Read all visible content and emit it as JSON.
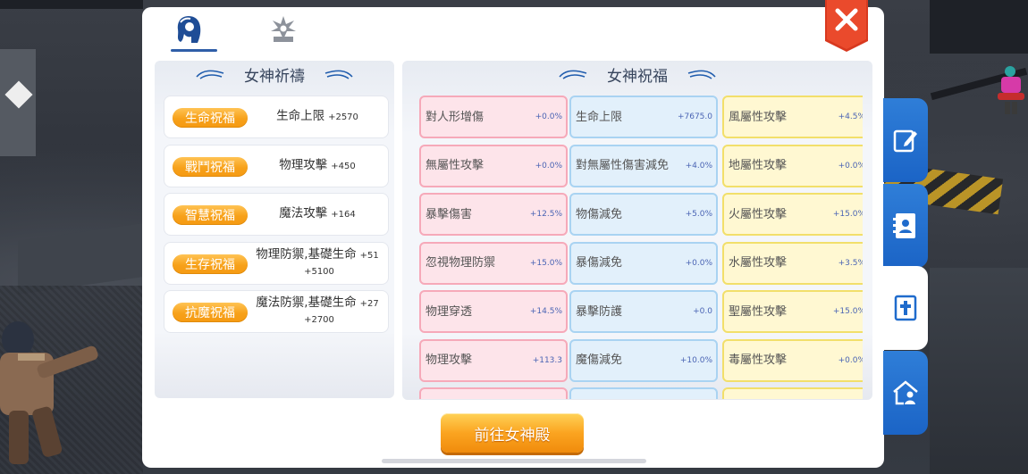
{
  "top_tabs": [
    {
      "icon": "goddess-head-icon",
      "active": true
    },
    {
      "icon": "star-emblem-icon",
      "active": false
    }
  ],
  "close_icon": "close-icon",
  "left_section": {
    "title": "女神祈禱",
    "rows": [
      {
        "badge": "生命祝福",
        "line1": "生命上限",
        "value1": "+2570",
        "line2": "",
        "value2": ""
      },
      {
        "badge": "戰鬥祝福",
        "line1": "物理攻擊",
        "value1": "+450",
        "line2": "",
        "value2": ""
      },
      {
        "badge": "智慧祝福",
        "line1": "魔法攻擊",
        "value1": "+164",
        "line2": "",
        "value2": ""
      },
      {
        "badge": "生存祝福",
        "line1": "物理防禦,基礎生命",
        "value1": "+51",
        "line2": "",
        "value2": "+5100"
      },
      {
        "badge": "抗魔祝福",
        "line1": "魔法防禦,基礎生命",
        "value1": "+27",
        "line2": "",
        "value2": "+2700"
      }
    ]
  },
  "right_section": {
    "title": "女神祝福",
    "columns": [
      {
        "color": "pink",
        "cells": [
          {
            "name": "對人形增傷",
            "value": "+0.0%"
          },
          {
            "name": "無屬性攻擊",
            "value": "+0.0%"
          },
          {
            "name": "暴擊傷害",
            "value": "+12.5%"
          },
          {
            "name": "忽視物理防禦",
            "value": "+15.0%"
          },
          {
            "name": "物理穿透",
            "value": "+14.5%"
          },
          {
            "name": "物理攻擊",
            "value": "+113.3"
          },
          {
            "name": "",
            "value": ""
          }
        ]
      },
      {
        "color": "blue",
        "cells": [
          {
            "name": "生命上限",
            "value": "+7675.0"
          },
          {
            "name": "對無屬性傷害減免",
            "value": "+4.0%"
          },
          {
            "name": "物傷減免",
            "value": "+5.0%"
          },
          {
            "name": "暴傷減免",
            "value": "+0.0%"
          },
          {
            "name": "暴擊防護",
            "value": "+0.0"
          },
          {
            "name": "魔傷減免",
            "value": "+10.0%"
          },
          {
            "name": "",
            "value": ""
          }
        ]
      },
      {
        "color": "yellow",
        "cells": [
          {
            "name": "風屬性攻擊",
            "value": "+4.5%"
          },
          {
            "name": "地屬性攻擊",
            "value": "+0.0%"
          },
          {
            "name": "火屬性攻擊",
            "value": "+15.0%"
          },
          {
            "name": "水屬性攻擊",
            "value": "+3.5%"
          },
          {
            "name": "聖屬性攻擊",
            "value": "+15.0%"
          },
          {
            "name": "毒屬性攻擊",
            "value": "+0.0%"
          },
          {
            "name": "",
            "value": ""
          }
        ]
      }
    ]
  },
  "goto_button": "前往女神殿",
  "side_tabs": [
    {
      "icon": "edit-note-icon",
      "active": false
    },
    {
      "icon": "contact-book-icon",
      "active": false
    },
    {
      "icon": "scripture-cross-icon",
      "active": true
    },
    {
      "icon": "home-person-icon",
      "active": false
    }
  ],
  "colors": {
    "accent_orange": "#f7a11a",
    "close_red": "#e2412b",
    "side_tab_blue": "#1f6bcc",
    "cell_pink": "#fde4ea",
    "cell_blue": "#e2f0fb",
    "cell_yellow": "#fff8d2"
  }
}
